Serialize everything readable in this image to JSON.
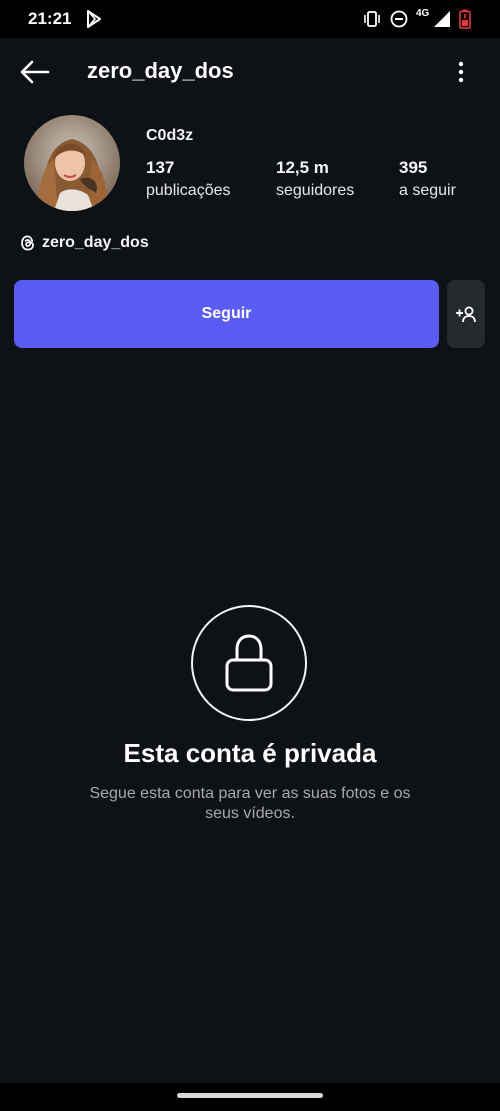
{
  "status_bar": {
    "time": "21:21",
    "network": "4G"
  },
  "header": {
    "username": "zero_day_dos"
  },
  "profile": {
    "display_name": "C0d3z",
    "stats": [
      {
        "value": "137",
        "label": "publicações"
      },
      {
        "value": "12,5 m",
        "label": "seguidores"
      },
      {
        "value": "395",
        "label": "a seguir"
      }
    ],
    "threads_handle": "zero_day_dos"
  },
  "actions": {
    "follow_label": "Seguir"
  },
  "private": {
    "title": "Esta conta é privada",
    "description": "Segue esta conta para ver as suas fotos e os seus vídeos."
  },
  "colors": {
    "accent": "#5b5cf6",
    "background": "#0e1116"
  }
}
